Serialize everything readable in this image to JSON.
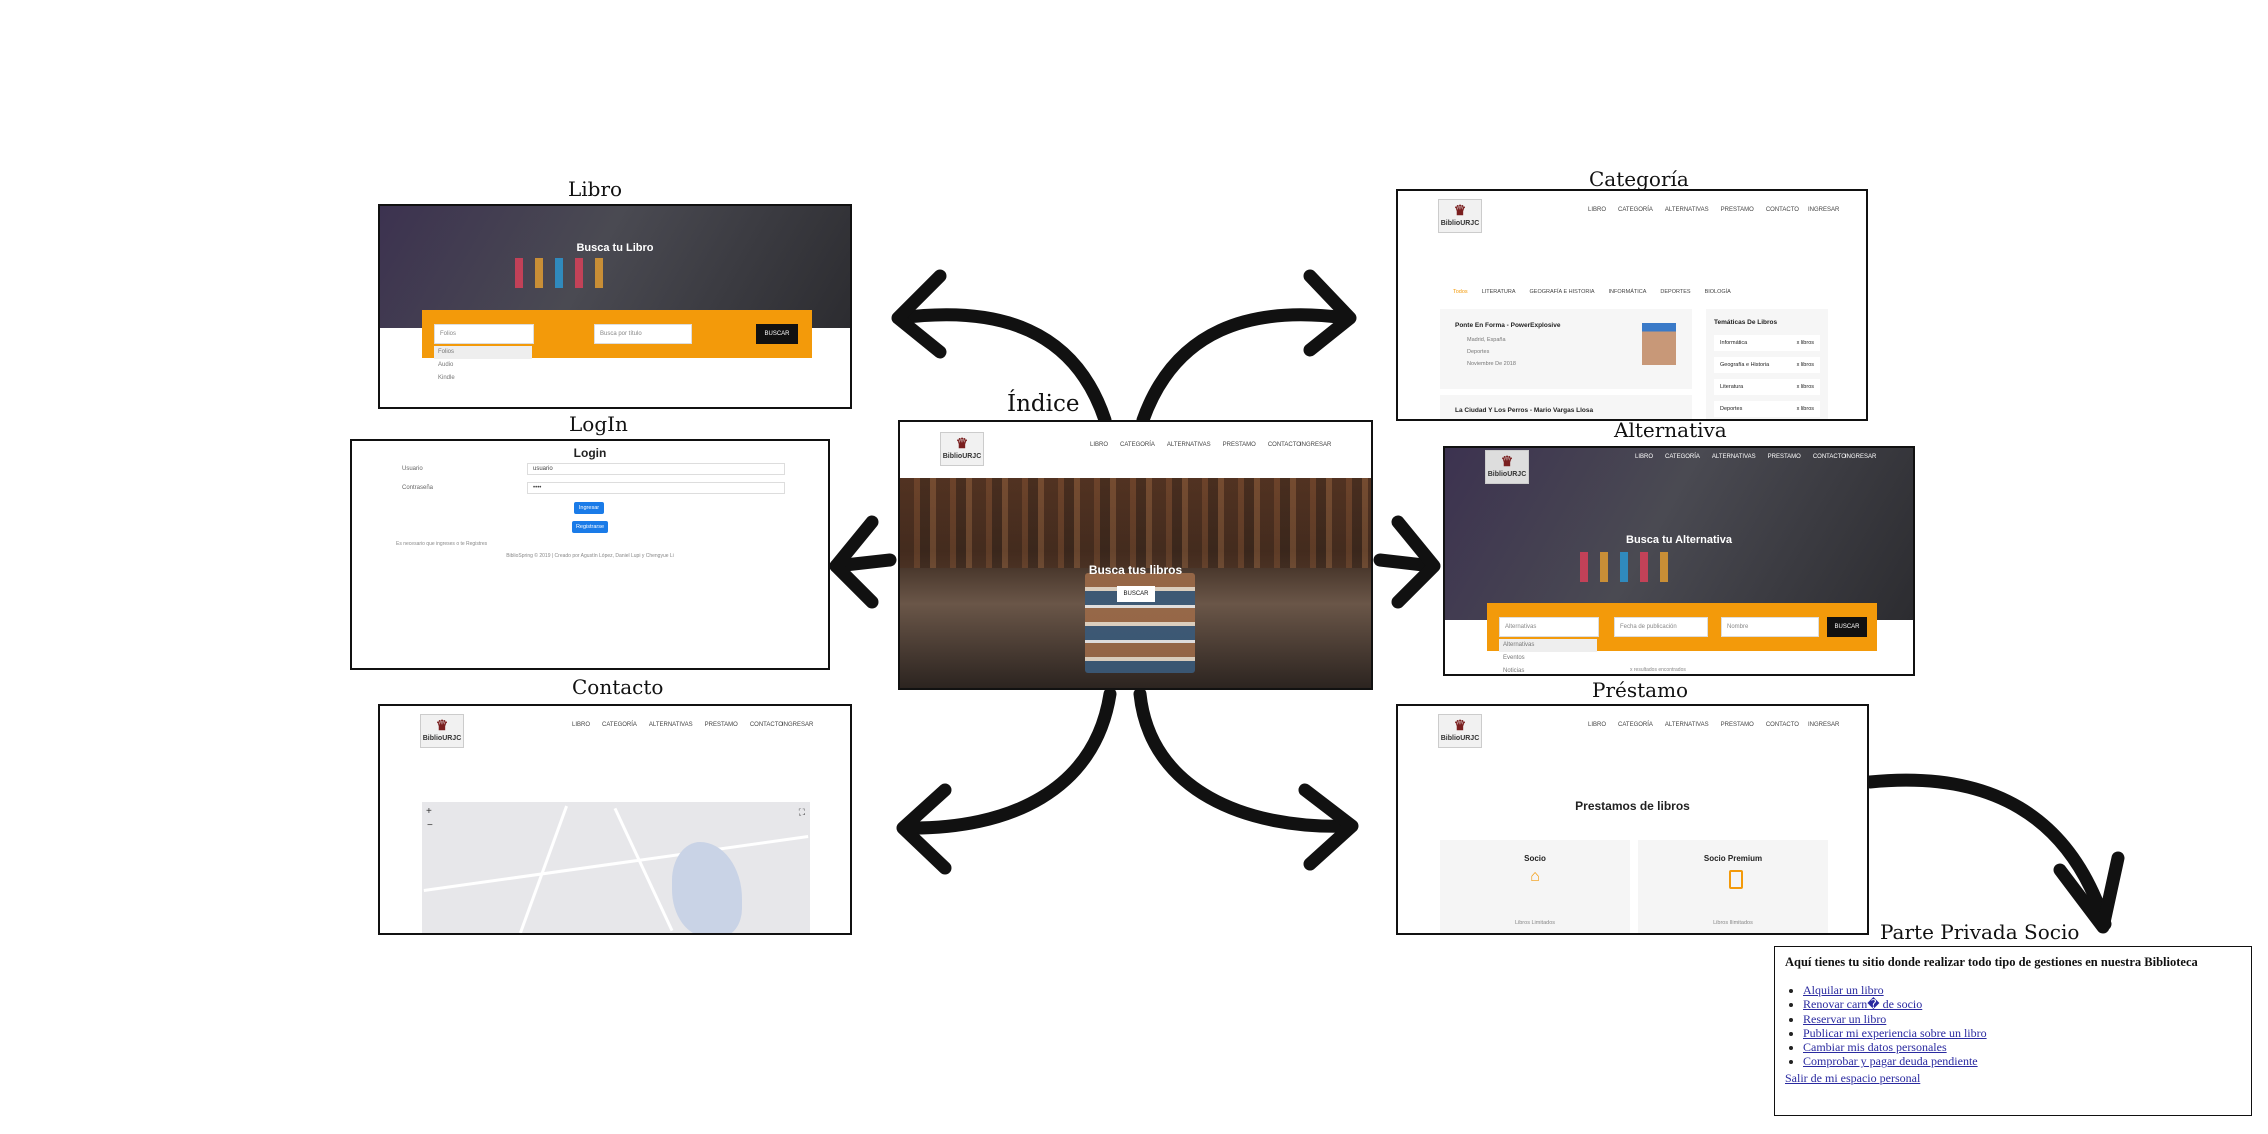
{
  "titles": {
    "libro": "Libro",
    "categoria": "Categoría",
    "indice": "Índice",
    "login": "LogIn",
    "alternativa": "Alternativa",
    "contacto": "Contacto",
    "prestamo": "Préstamo",
    "privada": "Parte Privada Socio"
  },
  "nav": {
    "logo": "BiblioURJC",
    "links": [
      "LIBRO",
      "CATEGORÍA",
      "ALTERNATIVAS",
      "PRESTAMO",
      "CONTACTO"
    ],
    "login": "INGRESAR"
  },
  "indice": {
    "heading": "Busca tus libros",
    "button": "BUSCAR"
  },
  "libro": {
    "heading": "Busca tu Libro",
    "select": "Folios",
    "options": [
      "Folios",
      "Audio",
      "Kindle"
    ],
    "search_placeholder": "Busca por título",
    "button": "BUSCAR"
  },
  "categoria": {
    "tabs": [
      "Todos",
      "LITERATURA",
      "GEOGRAFÍA E HISTORIA",
      "INFORMÁTICA",
      "DEPORTES",
      "BIOLOGÍA"
    ],
    "event1": {
      "title": "Ponte En Forma - PowerExplosive",
      "place": "Madrid, España",
      "cat": "Deportes",
      "date": "Noviembre De 2018"
    },
    "event2": {
      "title": "La Ciudad Y Los Perros - Mario Vargas Llosa"
    },
    "sidebar_title": "Temáticas De Libros",
    "sidebar": [
      {
        "name": "Informática",
        "count": "x libros"
      },
      {
        "name": "Geografía e Historia",
        "count": "x libros"
      },
      {
        "name": "Literatura",
        "count": "x libros"
      },
      {
        "name": "Deportes",
        "count": "x libros"
      }
    ]
  },
  "login": {
    "heading": "Login",
    "user_label": "Usuario",
    "user_value": "usuario",
    "pass_label": "Contraseña",
    "pass_value": "••••",
    "btn_login": "Ingresar",
    "btn_register": "Registrarse",
    "note": "Es necesario que ingreses o te Registres",
    "footer": "BiblioSpring © 2019 | Creado por Agustín López, Daniel Lupi y Chengyue Li"
  },
  "alternativa": {
    "heading": "Busca tu Alternativa",
    "select": "Alternativas",
    "options": [
      "Alternativas",
      "Eventos",
      "Noticias"
    ],
    "date_placeholder": "Fecha de publicación",
    "name_placeholder": "Nombre",
    "button": "BUSCAR",
    "results": "x resultados encontrados"
  },
  "prestamo": {
    "heading": "Prestamos de libros",
    "card1": {
      "title": "Socio",
      "note": "Libros Limitados"
    },
    "card2": {
      "title": "Socio Premium",
      "note": "Libros Ilimitados"
    }
  },
  "privada": {
    "heading": "Aquí tienes tu sitio donde realizar todo tipo de gestiones en nuestra Biblioteca",
    "links": [
      "Alquilar un libro",
      "Renovar carn� de socio",
      "Reservar un libro",
      "Publicar mi experiencia sobre un libro",
      "Cambiar mis datos personales",
      "Comprobar y pagar deuda pendiente"
    ],
    "logout": "Salir de mi espacio personal"
  },
  "colors": {
    "accent": "#f39a0a",
    "button": "#111111",
    "blue": "#1a7be8",
    "frame": "#111111"
  }
}
